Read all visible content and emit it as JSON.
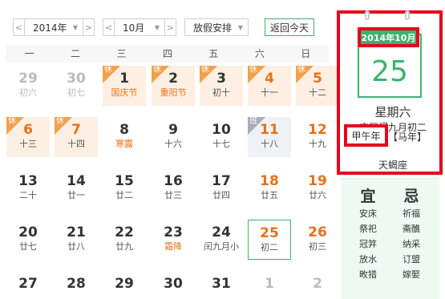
{
  "toolbar": {
    "prev_year": "<",
    "year": "2014年",
    "next_year": ">",
    "prev_month": "<",
    "month": "10月",
    "next_month": ">",
    "holiday": "放假安排",
    "today": "返回今天"
  },
  "weekdays": [
    "一",
    "二",
    "三",
    "四",
    "五",
    "六",
    "日"
  ],
  "days": [
    {
      "num": "29",
      "lunar": "初六",
      "other": true
    },
    {
      "num": "30",
      "lunar": "初七",
      "other": true
    },
    {
      "num": "1",
      "lunar": "国庆节",
      "tag": "休",
      "lunar_red": true
    },
    {
      "num": "2",
      "lunar": "重阳节",
      "tag": "休",
      "lunar_red": true
    },
    {
      "num": "3",
      "lunar": "初十",
      "tag": "休"
    },
    {
      "num": "4",
      "lunar": "十一",
      "tag": "休",
      "red": true
    },
    {
      "num": "5",
      "lunar": "十二",
      "tag": "休",
      "red": true
    },
    {
      "num": "6",
      "lunar": "十三",
      "tag": "休",
      "red": true
    },
    {
      "num": "7",
      "lunar": "十四",
      "tag": "休",
      "red": true
    },
    {
      "num": "8",
      "lunar": "寒露",
      "lunar_red": true
    },
    {
      "num": "9",
      "lunar": "十六"
    },
    {
      "num": "10",
      "lunar": "十七"
    },
    {
      "num": "11",
      "lunar": "十八",
      "tag": "班",
      "red": true
    },
    {
      "num": "12",
      "lunar": "十九",
      "red": true
    },
    {
      "num": "13",
      "lunar": "二十"
    },
    {
      "num": "14",
      "lunar": "廿一"
    },
    {
      "num": "15",
      "lunar": "廿二"
    },
    {
      "num": "16",
      "lunar": "廿三"
    },
    {
      "num": "17",
      "lunar": "廿四"
    },
    {
      "num": "18",
      "lunar": "廿五",
      "red": true
    },
    {
      "num": "19",
      "lunar": "廿六",
      "red": true
    },
    {
      "num": "20",
      "lunar": "廿七"
    },
    {
      "num": "21",
      "lunar": "廿八"
    },
    {
      "num": "22",
      "lunar": "廿九"
    },
    {
      "num": "23",
      "lunar": "霜降",
      "lunar_red": true
    },
    {
      "num": "24",
      "lunar": "闰九月小"
    },
    {
      "num": "25",
      "lunar": "初二",
      "red": true,
      "today": true
    },
    {
      "num": "26",
      "lunar": "初三",
      "red": true
    },
    {
      "num": "27",
      "lunar": ""
    },
    {
      "num": "28",
      "lunar": ""
    },
    {
      "num": "29",
      "lunar": ""
    },
    {
      "num": "30",
      "lunar": ""
    },
    {
      "num": "31",
      "lunar": ""
    },
    {
      "num": "1",
      "lunar": "",
      "other": true
    },
    {
      "num": "2",
      "lunar": "",
      "other": true
    }
  ],
  "side": {
    "header": "2014年10月",
    "day": "25",
    "weekday": "星期六",
    "lunar": "农历闰九月初二",
    "ganzhi": "甲午年",
    "zodiac": "【马年】",
    "xingzuo": "天蝎座"
  },
  "yiji": {
    "yi_title": "宜",
    "ji_title": "忌",
    "yi": [
      "安床",
      "祭祀",
      "冠笄",
      "放水",
      "畋猎"
    ],
    "ji": [
      "祈福",
      "斋醮",
      "纳采",
      "订盟",
      "嫁娶"
    ]
  },
  "colors": {
    "accent": "#3bb36d",
    "highlight": "#e8001c",
    "holiday_bg": "#fdf0e3",
    "orange": "#e8701a"
  }
}
